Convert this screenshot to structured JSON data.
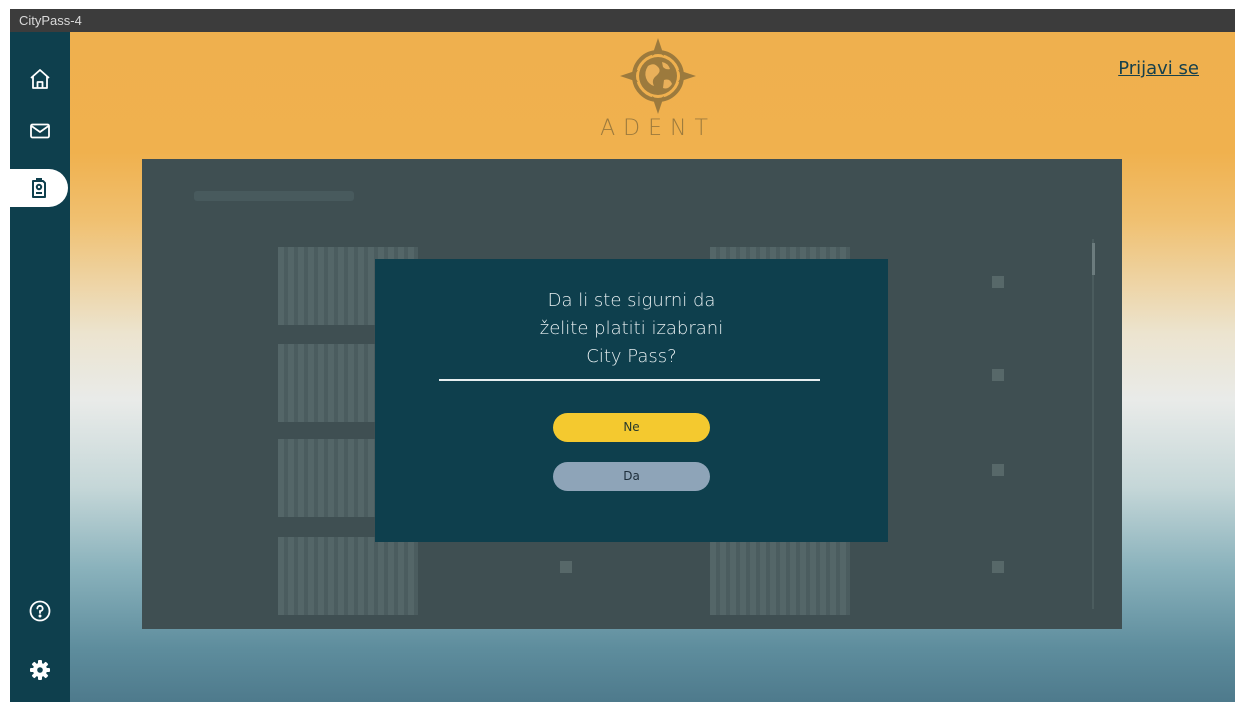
{
  "window": {
    "title": "CityPass-4"
  },
  "sidebar": {
    "items": [
      {
        "icon": "home-icon",
        "active": false
      },
      {
        "icon": "mail-icon",
        "active": false
      },
      {
        "icon": "pass-icon",
        "active": true
      }
    ],
    "bottom_items": [
      {
        "icon": "help-icon"
      },
      {
        "icon": "settings-icon"
      }
    ]
  },
  "header": {
    "logo_text": "ADENT",
    "login_label": "Prijavi se"
  },
  "dialog": {
    "message_lines": [
      "Da li ste sigurni da",
      "želite platiti izabrani",
      "City Pass?"
    ],
    "no_label": "Ne",
    "yes_label": "Da"
  },
  "colors": {
    "sidebar": "#0e3f4d",
    "dialog_bg": "#0e3f4d",
    "no_button": "#f4c92f",
    "yes_button": "#8ea4b8",
    "brand_gold": "#9c7a3d"
  }
}
